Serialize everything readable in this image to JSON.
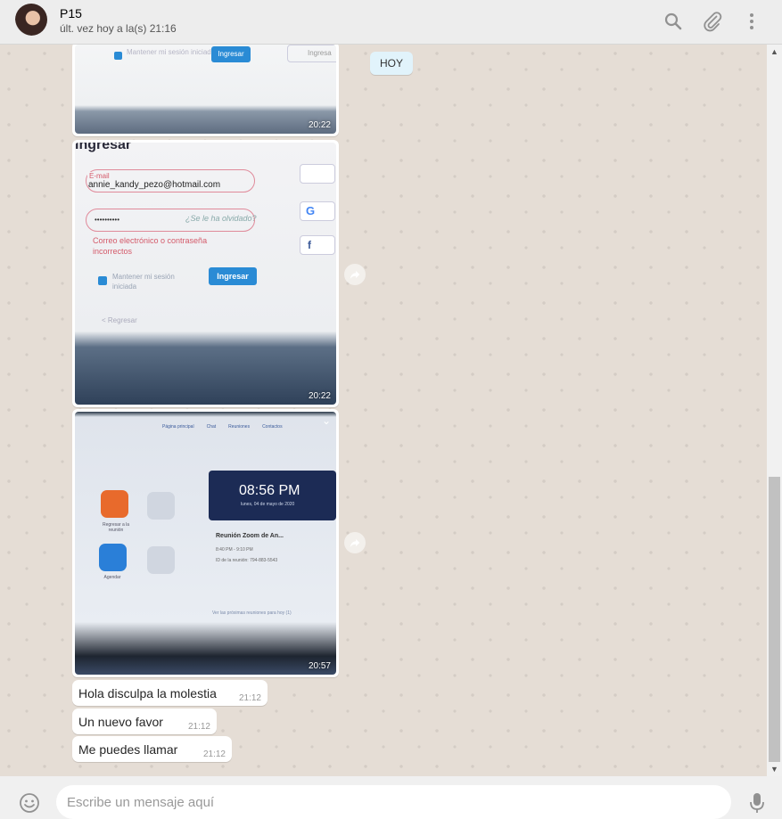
{
  "header": {
    "contact_name": "P15",
    "status": "últ. vez hoy a la(s) 21:16",
    "icons": [
      "search-icon",
      "attach-icon",
      "menu-icon"
    ]
  },
  "chat": {
    "date_divider": "HOY",
    "image_messages": [
      {
        "time": "20:22",
        "photo_text": {
          "login_button": "Ingresar",
          "remember": "Mantener mi sesión iniciada",
          "social": "Ingresa"
        }
      },
      {
        "time": "20:22",
        "photo_text": {
          "title": "Ingresar",
          "email_label": "E-mail",
          "email_value": "annie_kandy_pezo@hotmail.com",
          "password_value": "••••••••••",
          "forgot": "¿Se le ha olvidado?",
          "error": "Correo electrónico o contraseña incorrectos",
          "remember": "Mantener mi sesión iniciada",
          "login_button": "Ingresar",
          "back": "< Regresar"
        }
      },
      {
        "time": "20:57",
        "photo_text": {
          "nav": [
            "Página principal",
            "Chat",
            "Reuniones",
            "Contactos"
          ],
          "clock": "08:56 PM",
          "date": "lunes, 04 de mayo de 2020",
          "meeting_title": "Reunión Zoom de An...",
          "meeting_time": "8:40 PM - 9:10 PM",
          "meeting_id": "ID de la reunión: 794-883-5543",
          "rejoin": "Regresar a la reunión",
          "schedule": "Agendar",
          "upcoming": "Ver las próximas reuniones para hoy (1)"
        }
      }
    ],
    "text_messages": [
      {
        "text": "Hola disculpa la molestia",
        "time": "21:12"
      },
      {
        "text": "Un nuevo favor",
        "time": "21:12"
      },
      {
        "text": "Me puedes llamar",
        "time": "21:12"
      }
    ]
  },
  "composer": {
    "placeholder": "Escribe un mensaje aquí",
    "value": ""
  },
  "colors": {
    "header_bg": "#ededed",
    "chat_bg": "#e5ddd5",
    "bubble_in": "#ffffff",
    "date_chip": "#e1f3fb"
  }
}
